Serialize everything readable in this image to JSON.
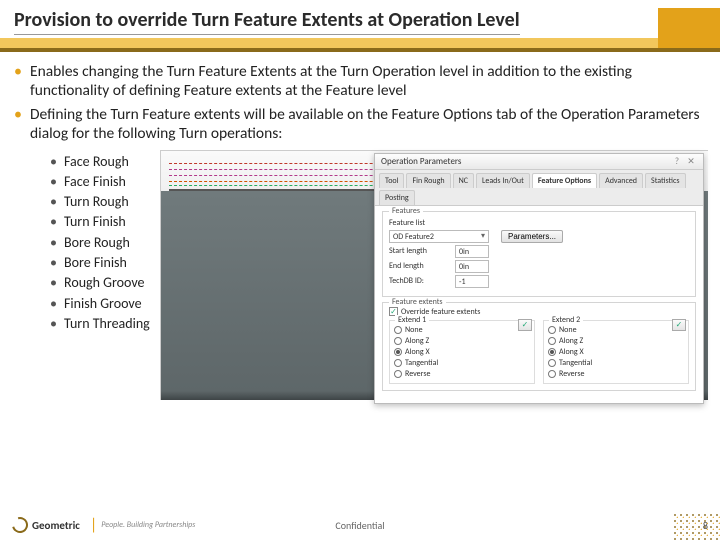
{
  "slide": {
    "title": "Provision to override Turn Feature Extents at Operation Level",
    "bullets": [
      "Enables changing the Turn Feature Extents at the Turn Operation level in addition to the existing functionality of defining Feature extents at the Feature level",
      "Defining the Turn Feature extents will be available on the Feature Options tab of the Operation Parameters dialog for the following Turn operations:"
    ],
    "sub_bullets": [
      "Face Rough",
      "Face Finish",
      "Turn Rough",
      "Turn Finish",
      "Bore Rough",
      "Bore Finish",
      "Rough Groove",
      "Finish Groove",
      "Turn Threading"
    ]
  },
  "dialog": {
    "title": "Operation Parameters",
    "tabs": [
      "Tool",
      "Fin Rough",
      "NC",
      "Leads In/Out",
      "Feature Options",
      "Advanced",
      "Statistics",
      "Posting"
    ],
    "active_tab": "Feature Options",
    "features_group": "Features",
    "feature_list_label": "Feature list",
    "feature_value": "OD Feature2",
    "parameters_btn": "Parameters...",
    "start_len_label": "Start length",
    "end_len_label": "End length",
    "techdb_label": "TechDB ID:",
    "start_len_val": "0in",
    "end_len_val": "0in",
    "techdb_val": "-1",
    "extents_group": "Feature extents",
    "override_label": "Override feature extents",
    "override_checked": true,
    "extend1": "Extend 1",
    "extend2": "Extend 2",
    "radio_options": [
      "None",
      "Along Z",
      "Along X",
      "Tangential",
      "Reverse"
    ],
    "ext1_selected": "Along X",
    "ext2_selected": "Along X"
  },
  "footer": {
    "brand": "Geometric",
    "tagline": "People. Building Partnerships",
    "confidential": "Confidential",
    "page": "8"
  }
}
